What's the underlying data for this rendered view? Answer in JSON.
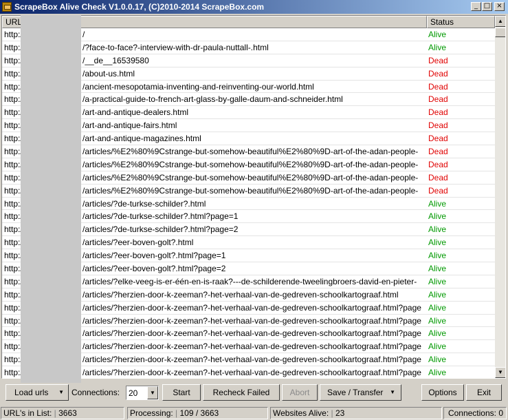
{
  "window": {
    "title": "ScrapeBox Alive Check V1.0.0.17, (C)2010-2014 ScrapeBox.com"
  },
  "titlebar_buttons": {
    "minimize": "_",
    "maximize": "□",
    "close": "×"
  },
  "columns": {
    "url": "URL",
    "status": "Status"
  },
  "colors": {
    "alive": "#009900",
    "dead": "#e00000"
  },
  "rows": [
    {
      "url": "http://",
      "path": "/",
      "status": "Alive"
    },
    {
      "url": "http://",
      "path": "/?face-to-face?-interview-with-dr-paula-nuttall-.html",
      "status": "Alive"
    },
    {
      "url": "http://",
      "path": "/__de__16539580",
      "status": "Dead"
    },
    {
      "url": "http://",
      "path": "/about-us.html",
      "status": "Dead"
    },
    {
      "url": "http://",
      "path": "/ancient-mesopotamia-inventing-and-reinventing-our-world.html",
      "status": "Dead"
    },
    {
      "url": "http://",
      "path": "/a-practical-guide-to-french-art-glass-by-galle-daum-and-schneider.html",
      "status": "Dead"
    },
    {
      "url": "http://",
      "path": "/art-and-antique-dealers.html",
      "status": "Dead"
    },
    {
      "url": "http://",
      "path": "/art-and-antique-fairs.html",
      "status": "Dead"
    },
    {
      "url": "http://",
      "path": "/art-and-antique-magazines.html",
      "status": "Dead"
    },
    {
      "url": "http://",
      "path": "/articles/%E2%80%9Cstrange-but-somehow-beautiful%E2%80%9D-art-of-the-adan-people-",
      "status": "Dead"
    },
    {
      "url": "http://",
      "path": "/articles/%E2%80%9Cstrange-but-somehow-beautiful%E2%80%9D-art-of-the-adan-people-",
      "status": "Dead"
    },
    {
      "url": "http://",
      "path": "/articles/%E2%80%9Cstrange-but-somehow-beautiful%E2%80%9D-art-of-the-adan-people-",
      "status": "Dead"
    },
    {
      "url": "http://",
      "path": "/articles/%E2%80%9Cstrange-but-somehow-beautiful%E2%80%9D-art-of-the-adan-people-",
      "status": "Dead"
    },
    {
      "url": "http://",
      "path": "/articles/?de-turkse-schilder?.html",
      "status": "Alive"
    },
    {
      "url": "http://",
      "path": "/articles/?de-turkse-schilder?.html?page=1",
      "status": "Alive"
    },
    {
      "url": "http://",
      "path": "/articles/?de-turkse-schilder?.html?page=2",
      "status": "Alive"
    },
    {
      "url": "http://",
      "path": "/articles/?eer-boven-golt?.html",
      "status": "Alive"
    },
    {
      "url": "http://",
      "path": "/articles/?eer-boven-golt?.html?page=1",
      "status": "Alive"
    },
    {
      "url": "http://",
      "path": "/articles/?eer-boven-golt?.html?page=2",
      "status": "Alive"
    },
    {
      "url": "http://",
      "path": "/articles/?elke-veeg-is-er-één-en-is-raak?---de-schilderende-tweelingbroers-david-en-pieter-",
      "status": "Alive"
    },
    {
      "url": "http://",
      "path": "/articles/?herzien-door-k-zeeman?-het-verhaal-van-de-gedreven-schoolkartograaf.html",
      "status": "Alive"
    },
    {
      "url": "http://",
      "path": "/articles/?herzien-door-k-zeeman?-het-verhaal-van-de-gedreven-schoolkartograaf.html?page",
      "status": "Alive"
    },
    {
      "url": "http://",
      "path": "/articles/?herzien-door-k-zeeman?-het-verhaal-van-de-gedreven-schoolkartograaf.html?page",
      "status": "Alive"
    },
    {
      "url": "http://",
      "path": "/articles/?herzien-door-k-zeeman?-het-verhaal-van-de-gedreven-schoolkartograaf.html?page",
      "status": "Alive"
    },
    {
      "url": "http://",
      "path": "/articles/?herzien-door-k-zeeman?-het-verhaal-van-de-gedreven-schoolkartograaf.html?page",
      "status": "Alive"
    },
    {
      "url": "http://",
      "path": "/articles/?herzien-door-k-zeeman?-het-verhaal-van-de-gedreven-schoolkartograaf.html?page",
      "status": "Alive"
    },
    {
      "url": "http://",
      "path": "/articles/?herzien-door-k-zeeman?-het-verhaal-van-de-gedreven-schoolkartograaf.html?page",
      "status": "Alive"
    }
  ],
  "toolbar": {
    "load_urls": "Load urls",
    "connections_label": "Connections:",
    "connections_value": "20",
    "start": "Start",
    "recheck_failed": "Recheck Failed",
    "abort": "Abort",
    "save_transfer": "Save / Transfer",
    "options": "Options",
    "exit": "Exit"
  },
  "statusbar": {
    "urls_label": "URL's in List:",
    "urls_value": "3663",
    "processing_label": "Processing:",
    "processing_value": "109 / 3663",
    "alive_label": "Websites Alive:",
    "alive_value": "23",
    "connections": "Connections: 0"
  },
  "icons": {
    "app": "box-icon",
    "dropdown": "chevron-down-icon",
    "scroll_up": "arrow-up-icon",
    "scroll_down": "arrow-down-icon"
  }
}
